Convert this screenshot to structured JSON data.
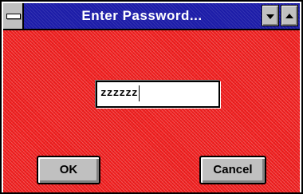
{
  "window": {
    "title": "Enter Password...",
    "client_color": "#f22020",
    "titlebar_color": "#1c1ca8"
  },
  "titlebar": {
    "system_menu_icon": "system-menu-icon",
    "minimize_icon": "minimize-arrow-icon",
    "maximize_icon": "maximize-arrow-icon"
  },
  "password_field": {
    "value": "zzzzzz"
  },
  "buttons": {
    "ok_label": "OK",
    "cancel_label": "Cancel"
  }
}
